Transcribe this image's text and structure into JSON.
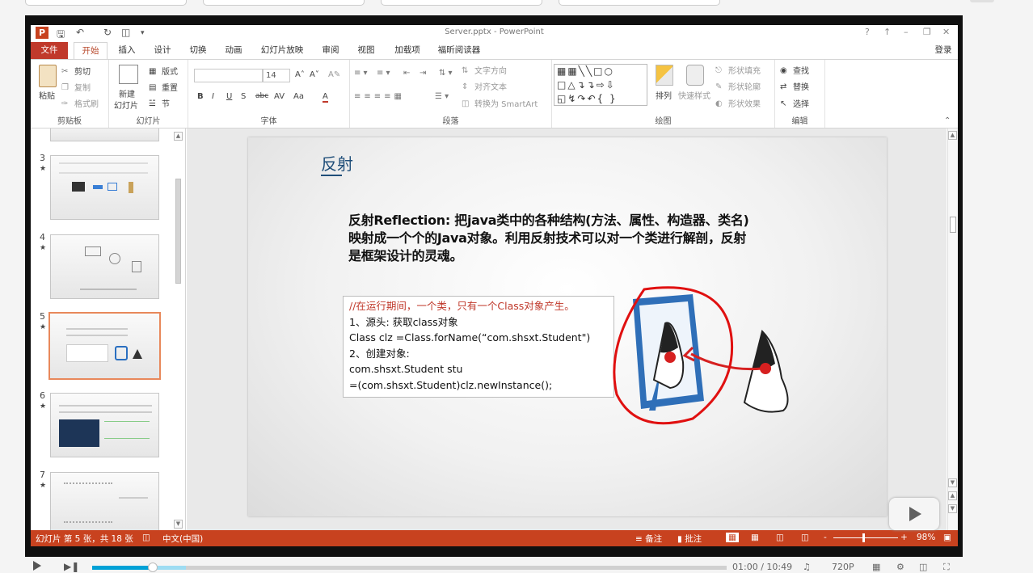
{
  "app": {
    "title": "Server.pptx - PowerPoint",
    "help": "?",
    "window_controls": [
      "↑",
      "–",
      "❐",
      "✕"
    ]
  },
  "tabs": [
    "文件",
    "开始",
    "插入",
    "设计",
    "切换",
    "动画",
    "幻灯片放映",
    "审阅",
    "视图",
    "加载项",
    "福昕阅读器"
  ],
  "active_tab": "开始",
  "login": "登录",
  "ribbon": {
    "clipboard": {
      "label": "剪贴板",
      "paste": "粘贴",
      "cut": "剪切",
      "copy": "复制",
      "format_painter": "格式刷"
    },
    "slides": {
      "label": "幻灯片",
      "new_slide_1": "新建",
      "new_slide_2": "幻灯片",
      "layout": "版式",
      "reset": "重置",
      "section": "节"
    },
    "font": {
      "label": "字体",
      "font_name": "",
      "font_size": "14",
      "bold": "B",
      "italic": "I",
      "underline": "U",
      "shadow": "S",
      "strike": "abc",
      "spacing": "AV",
      "case": "Aa",
      "color": "A",
      "grow": "A˄",
      "shrink": "A˅",
      "clear": "A✎"
    },
    "paragraph": {
      "label": "段落",
      "text_direction": "文字方向",
      "align_text": "对齐文本",
      "smartart": "转换为 SmartArt"
    },
    "drawing": {
      "label": "绘图",
      "arrange": "排列",
      "quick_styles": "快速样式",
      "shape_fill": "形状填充",
      "shape_outline": "形状轮廓",
      "shape_effects": "形状效果"
    },
    "editing": {
      "label": "编辑",
      "find": "查找",
      "replace": "替换",
      "select": "选择"
    }
  },
  "thumbnails": [
    {
      "num": "3",
      "star": "★"
    },
    {
      "num": "4",
      "star": "★"
    },
    {
      "num": "5",
      "star": "★"
    },
    {
      "num": "6",
      "star": "★"
    },
    {
      "num": "7",
      "star": "★"
    }
  ],
  "selected_slide": "5",
  "slide": {
    "title": "反射",
    "body": "反射Reflection: 把java类中的各种结构(方法、属性、构造器、类名)映射成一个个的Java对象。利用反射技术可以对一个类进行解剖，反射是框架设计的灵魂。",
    "code": {
      "comment": "//在运行期间，一个类，只有一个Class对象产生。",
      "line1": "1、源头: 获取class对象",
      "line2": "Class clz =Class.forName(“com.shsxt.Student\")",
      "line3": "2、创建对象:",
      "line4": "com.shsxt.Student stu",
      "line5": "=(com.shsxt.Student)clz.newInstance();"
    }
  },
  "status": {
    "slide_info": "幻灯片 第 5 张，共 18 张",
    "language": "中文(中国)",
    "notes": "备注",
    "comments": "批注",
    "zoom": "98%",
    "minus": "-",
    "plus": "+"
  },
  "player": {
    "time": "01:00 / 10:49",
    "quality": "720P",
    "progress_fraction": 0.093
  },
  "colors": {
    "accent": "#c8421f",
    "file_tab": "#c0392b",
    "title_blue": "#1f4e79",
    "code_red": "#c0392b",
    "player_blue": "#00a1d6"
  }
}
